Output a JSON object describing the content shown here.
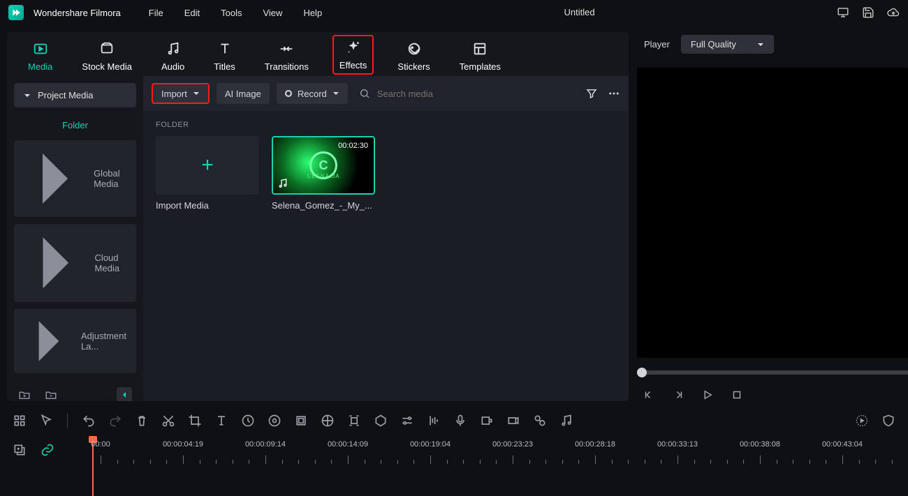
{
  "app": {
    "title": "Wondershare Filmora",
    "document": "Untitled"
  },
  "menu": [
    "File",
    "Edit",
    "Tools",
    "View",
    "Help"
  ],
  "tabs": [
    {
      "label": "Media",
      "active": true
    },
    {
      "label": "Stock Media"
    },
    {
      "label": "Audio"
    },
    {
      "label": "Titles"
    },
    {
      "label": "Transitions"
    },
    {
      "label": "Effects",
      "highlight": true
    },
    {
      "label": "Stickers"
    },
    {
      "label": "Templates"
    }
  ],
  "sidebar": {
    "project": "Project Media",
    "folder": "Folder",
    "items": [
      "Global Media",
      "Cloud Media",
      "Adjustment La..."
    ]
  },
  "toolbar": {
    "import": "Import",
    "ai_image": "AI Image",
    "record": "Record",
    "search_placeholder": "Search media"
  },
  "folder_label": "FOLDER",
  "cards": {
    "import_label": "Import Media",
    "media": {
      "duration": "00:02:30",
      "name": "Selena_Gomez_-_My_...",
      "badge": "CEENAIJA"
    }
  },
  "player": {
    "label": "Player",
    "quality": "Full Quality"
  },
  "timeline": {
    "times": [
      "00:00",
      "00:00:04:19",
      "00:00:09:14",
      "00:00:14:09",
      "00:00:19:04",
      "00:00:23:23",
      "00:00:28:18",
      "00:00:33:13",
      "00:00:38:08",
      "00:00:43:04"
    ]
  }
}
